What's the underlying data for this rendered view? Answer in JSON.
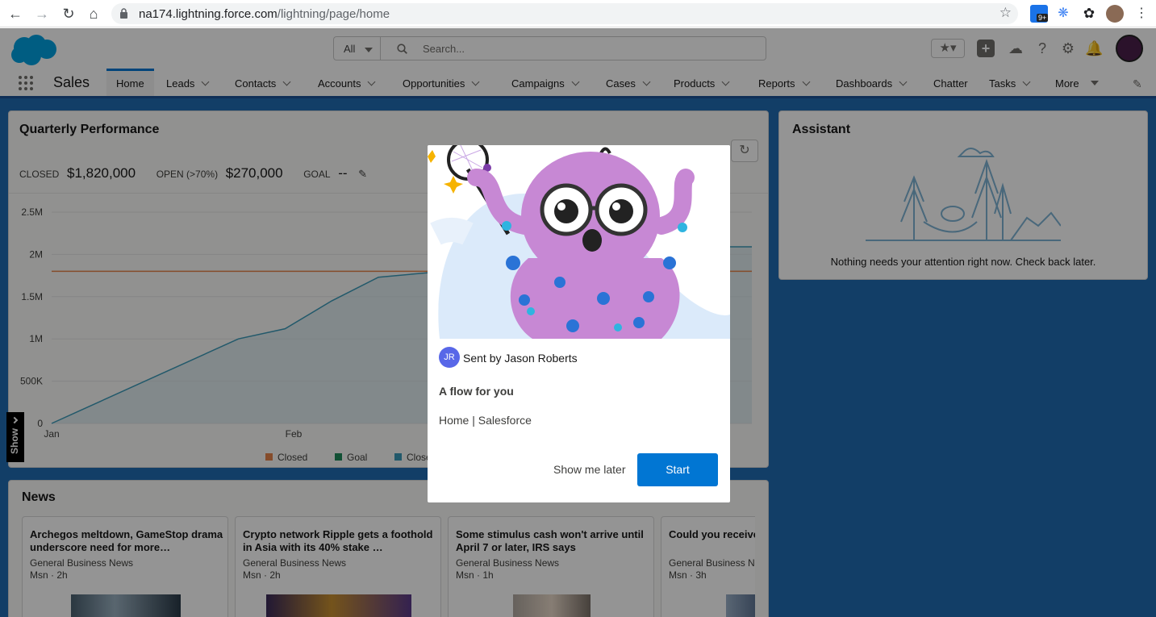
{
  "browser": {
    "url_host": "na174.lightning.force.com",
    "url_path": "/lightning/page/home",
    "ext_badge": "9+"
  },
  "header": {
    "search_scope": "All",
    "search_placeholder": "Search..."
  },
  "nav": {
    "app_name": "Sales",
    "items": [
      {
        "label": "Home",
        "dropdown": false
      },
      {
        "label": "Leads",
        "dropdown": true
      },
      {
        "label": "Contacts",
        "dropdown": true
      },
      {
        "label": "Accounts",
        "dropdown": true
      },
      {
        "label": "Opportunities",
        "dropdown": true
      },
      {
        "label": "Campaigns",
        "dropdown": true
      },
      {
        "label": "Cases",
        "dropdown": true
      },
      {
        "label": "Products",
        "dropdown": true
      },
      {
        "label": "Reports",
        "dropdown": true
      },
      {
        "label": "Dashboards",
        "dropdown": true
      },
      {
        "label": "Chatter",
        "dropdown": false
      },
      {
        "label": "Tasks",
        "dropdown": true
      },
      {
        "label": "More",
        "dropdown": true
      }
    ]
  },
  "performance": {
    "title": "Quarterly Performance",
    "closed_label": "CLOSED",
    "closed_value": "$1,820,000",
    "open_label": "OPEN (>70%)",
    "open_value": "$270,000",
    "goal_label": "GOAL",
    "goal_value": "--"
  },
  "chart_data": {
    "type": "line",
    "x_ticks": [
      "Jan",
      "Feb"
    ],
    "yticks": [
      "0",
      "500K",
      "1M",
      "1.5M",
      "2M",
      "2.5M"
    ],
    "ylim": [
      0,
      2500000
    ],
    "legend": [
      "Closed",
      "Goal",
      "Closed"
    ],
    "legend_colors": [
      "#e6844a",
      "#1e8a5a",
      "#3b9ab8"
    ],
    "goal_line": 1800000,
    "series": [
      {
        "values": [
          0,
          250000,
          500000,
          750000,
          1000000,
          1120000,
          1450000,
          1730000,
          1780000,
          1830000,
          1850000,
          1980000,
          2000000,
          2090000,
          2090000,
          2090000
        ]
      }
    ]
  },
  "assistant": {
    "title": "Assistant",
    "message": "Nothing needs your attention right now. Check back later."
  },
  "news": {
    "title": "News",
    "items": [
      {
        "headline": "Archegos meltdown, GameStop drama underscore need for more…",
        "source": "General Business News",
        "meta": "Msn · 2h"
      },
      {
        "headline": "Crypto network Ripple gets a foothold in Asia with its 40% stake …",
        "source": "General Business News",
        "meta": "Msn · 2h"
      },
      {
        "headline": "Some stimulus cash won't arrive until April 7 or later, IRS says",
        "source": "General Business News",
        "meta": "Msn · 1h"
      },
      {
        "headline": "Could you receive check? Momentu",
        "source": "General Business N",
        "meta": "Msn · 3h"
      }
    ]
  },
  "modal": {
    "sender_initials": "JR",
    "sent_by": "Sent by Jason Roberts",
    "heading": "A flow for you",
    "link": "Home | Salesforce",
    "later_label": "Show me later",
    "start_label": "Start"
  },
  "show_tab": "Show"
}
